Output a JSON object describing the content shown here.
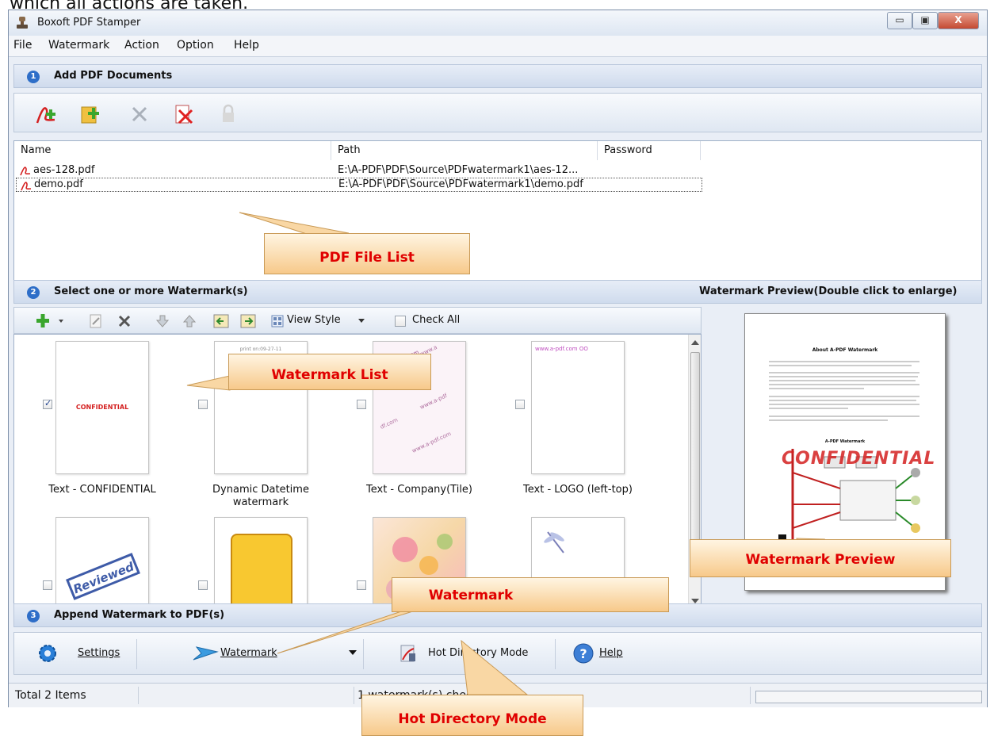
{
  "caption": "which all actions are taken.",
  "window": {
    "title": "Boxoft PDF Stamper",
    "controls": {
      "minimize": "▭",
      "restore": "▣",
      "close": "X"
    }
  },
  "menu": [
    "File",
    "Watermark",
    "Action",
    "Option",
    "Help"
  ],
  "section1": {
    "num": "1",
    "title": "Add PDF Documents"
  },
  "toolbar1_icons": [
    "add-pdf-icon",
    "add-folder-icon",
    "remove-icon",
    "remove-all-icon",
    "lock-icon"
  ],
  "filelist": {
    "columns": [
      "Name",
      "Path",
      "Password"
    ],
    "rows": [
      {
        "name": "aes-128.pdf",
        "path": "E:\\A-PDF\\PDF\\Source\\PDFwatermark1\\aes-12...",
        "password": ""
      },
      {
        "name": "demo.pdf",
        "path": "E:\\A-PDF\\PDF\\Source\\PDFwatermark1\\demo.pdf",
        "password": ""
      }
    ]
  },
  "callouts": {
    "file_list": "PDF File List",
    "watermark_list": "Watermark List",
    "watermark_preview": "Watermark Preview",
    "watermark": "Watermark",
    "hot_dir": "Hot Directory Mode"
  },
  "section2": {
    "num": "2",
    "title": "Select one or more Watermark(s)",
    "preview_title": "Watermark Preview(Double click to enlarge)"
  },
  "toolbar2": {
    "view_style": "View Style",
    "check_all": "Check All"
  },
  "watermarks": [
    {
      "label": "Text - CONFIDENTIAL",
      "checked": true,
      "thumb_text": "CONFIDENTIAL"
    },
    {
      "label": "Dynamic Datetime watermark",
      "checked": false,
      "thumb_text": "print on:09-27-11"
    },
    {
      "label": "Text - Company(Tile)",
      "checked": false,
      "thumb_text": "www.a-pdf.com"
    },
    {
      "label": "Text - LOGO (left-top)",
      "checked": false,
      "thumb_text": "www.a-pdf.com OO"
    },
    {
      "label": "",
      "checked": false,
      "thumb_text": "Reviewed"
    },
    {
      "label": "",
      "checked": false,
      "thumb_text": ""
    },
    {
      "label": "",
      "checked": false,
      "thumb_text": ""
    },
    {
      "label": "",
      "checked": false,
      "thumb_text": ""
    }
  ],
  "preview": {
    "heading": "About A-PDF Watermark",
    "stamp": "CONFIDENTIAL",
    "diagram_title": "A-PDF Watermark"
  },
  "section3": {
    "num": "3",
    "title": "Append Watermark to PDF(s)"
  },
  "actions": {
    "settings": "Settings",
    "watermark": "Watermark",
    "hot_directory": "Hot Directory Mode",
    "help": "Help"
  },
  "status": {
    "total": "Total 2 Items",
    "checked": "1 watermark(s) chec"
  },
  "colors": {
    "accent": "#2e6ec8",
    "callout_text": "#e00000",
    "confidential": "#d42020"
  }
}
